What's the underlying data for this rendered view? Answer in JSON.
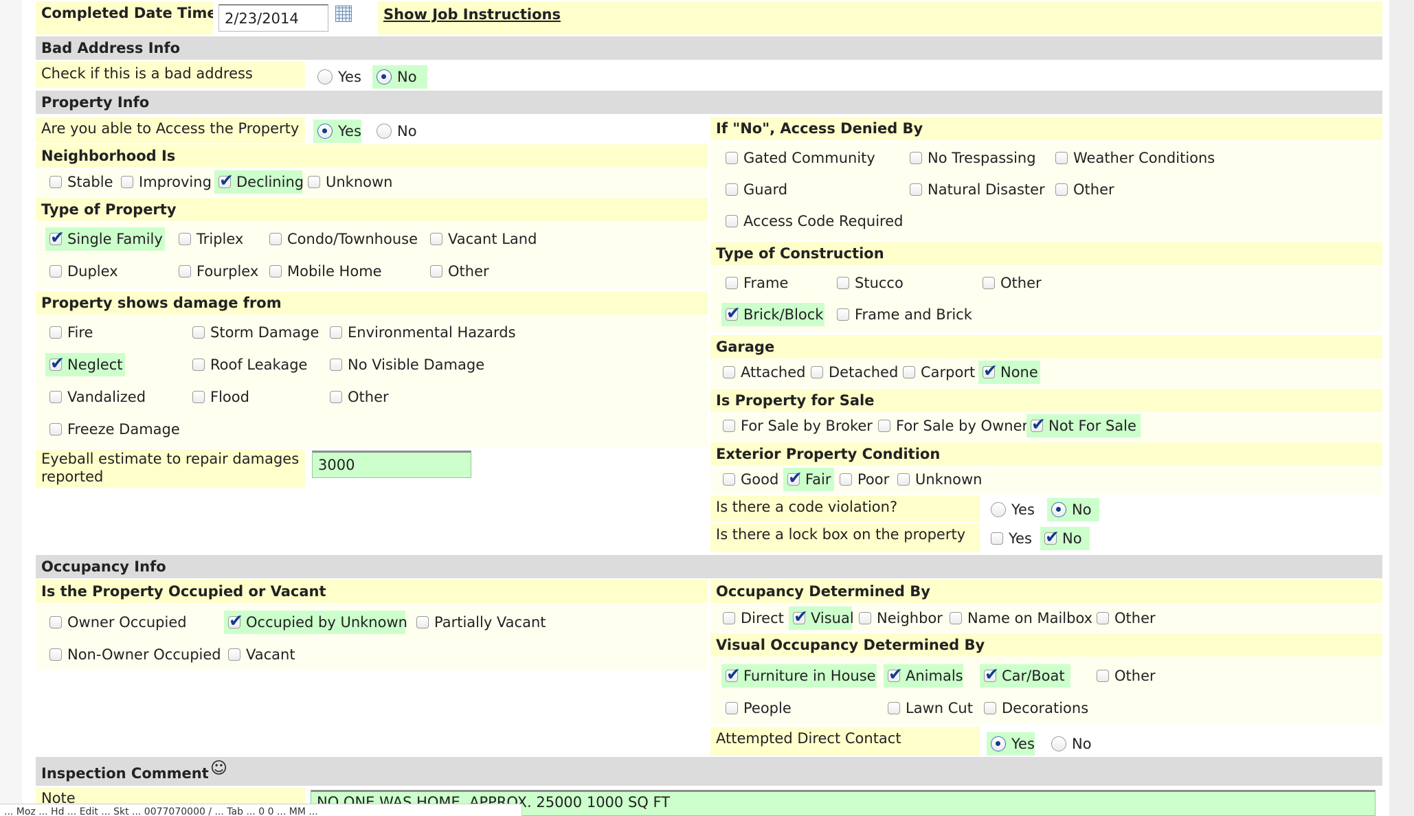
{
  "completed": {
    "label": "Completed Date Time",
    "date_value": "2/23/2014",
    "show_instructions": "Show Job Instructions"
  },
  "bad_address": {
    "section": "Bad Address Info",
    "question": "Check if this is a bad address",
    "options": [
      "Yes",
      "No"
    ],
    "selected": "No"
  },
  "property_info": {
    "section": "Property Info",
    "access_question": "Are you able to Access the Property",
    "access_options": [
      "Yes",
      "No"
    ],
    "access_selected": "Yes",
    "neighborhood": {
      "title": "Neighborhood Is",
      "options": [
        {
          "label": "Stable",
          "checked": false
        },
        {
          "label": "Improving",
          "checked": false
        },
        {
          "label": "Declining",
          "checked": true
        },
        {
          "label": "Unknown",
          "checked": false
        }
      ]
    },
    "type_of_property": {
      "title": "Type of Property",
      "options": [
        {
          "label": "Single Family",
          "checked": true
        },
        {
          "label": "Triplex",
          "checked": false
        },
        {
          "label": "Condo/Townhouse",
          "checked": false
        },
        {
          "label": "Vacant Land",
          "checked": false
        },
        {
          "label": "Duplex",
          "checked": false
        },
        {
          "label": "Fourplex",
          "checked": false
        },
        {
          "label": "Mobile Home",
          "checked": false
        },
        {
          "label": "Other",
          "checked": false
        }
      ]
    },
    "damage": {
      "title": "Property shows damage from",
      "options": [
        {
          "label": "Fire",
          "checked": false
        },
        {
          "label": "Storm Damage",
          "checked": false
        },
        {
          "label": "Environmental Hazards",
          "checked": false
        },
        {
          "label": "Neglect",
          "checked": true
        },
        {
          "label": "Roof Leakage",
          "checked": false
        },
        {
          "label": "No Visible Damage",
          "checked": false
        },
        {
          "label": "Vandalized",
          "checked": false
        },
        {
          "label": "Flood",
          "checked": false
        },
        {
          "label": "Other",
          "checked": false
        },
        {
          "label": "Freeze Damage",
          "checked": false
        }
      ]
    },
    "repair_estimate": {
      "label_line1": "Eyeball estimate to repair damages",
      "label_line2": "reported",
      "value": "3000"
    },
    "access_denied": {
      "title": "If \"No\", Access Denied By",
      "options": [
        {
          "label": "Gated Community",
          "checked": false
        },
        {
          "label": "No Trespassing",
          "checked": false
        },
        {
          "label": "Weather Conditions",
          "checked": false
        },
        {
          "label": "Guard",
          "checked": false
        },
        {
          "label": "Natural Disaster",
          "checked": false
        },
        {
          "label": "Other",
          "checked": false
        },
        {
          "label": "Access Code Required",
          "checked": false
        }
      ]
    },
    "construction": {
      "title": "Type of Construction",
      "options": [
        {
          "label": "Frame",
          "checked": false
        },
        {
          "label": "Stucco",
          "checked": false
        },
        {
          "label": "Other",
          "checked": false
        },
        {
          "label": "Brick/Block",
          "checked": true
        },
        {
          "label": "Frame and Brick",
          "checked": false
        }
      ]
    },
    "garage": {
      "title": "Garage",
      "options": [
        {
          "label": "Attached",
          "checked": false
        },
        {
          "label": "Detached",
          "checked": false
        },
        {
          "label": "Carport",
          "checked": false
        },
        {
          "label": "None",
          "checked": true
        }
      ]
    },
    "for_sale": {
      "title": "Is Property for Sale",
      "options": [
        {
          "label": "For Sale by Broker",
          "checked": false
        },
        {
          "label": "For Sale by Owner",
          "checked": false
        },
        {
          "label": "Not For Sale",
          "checked": true
        }
      ]
    },
    "exterior": {
      "title": "Exterior Property Condition",
      "options": [
        {
          "label": "Good",
          "checked": false
        },
        {
          "label": "Fair",
          "checked": true
        },
        {
          "label": "Poor",
          "checked": false
        },
        {
          "label": "Unknown",
          "checked": false
        }
      ]
    },
    "code_violation": {
      "question": "Is there a code violation?",
      "options": [
        "Yes",
        "No"
      ],
      "selected": "No"
    },
    "lock_box": {
      "question": "Is there a lock box on the property",
      "options": [
        {
          "label": "Yes",
          "checked": false
        },
        {
          "label": "No",
          "checked": true
        }
      ]
    }
  },
  "occupancy": {
    "section": "Occupancy Info",
    "occupied_or_vacant": {
      "title": "Is the Property Occupied or Vacant",
      "options": [
        {
          "label": "Owner Occupied",
          "checked": false
        },
        {
          "label": "Occupied by Unknown",
          "checked": true
        },
        {
          "label": "Partially Vacant",
          "checked": false
        },
        {
          "label": "Non-Owner Occupied",
          "checked": false
        },
        {
          "label": "Vacant",
          "checked": false
        }
      ]
    },
    "determined_by": {
      "title": "Occupancy Determined By",
      "options": [
        {
          "label": "Direct",
          "checked": false
        },
        {
          "label": "Visual",
          "checked": true
        },
        {
          "label": "Neighbor",
          "checked": false
        },
        {
          "label": "Name on Mailbox",
          "checked": false
        },
        {
          "label": "Other",
          "checked": false
        }
      ]
    },
    "visual_determined_by": {
      "title": "Visual Occupancy Determined By",
      "options": [
        {
          "label": "Furniture in House",
          "checked": true
        },
        {
          "label": "Animals",
          "checked": true
        },
        {
          "label": "Car/Boat",
          "checked": true
        },
        {
          "label": "Other",
          "checked": false
        },
        {
          "label": "People",
          "checked": false
        },
        {
          "label": "Lawn Cut",
          "checked": false
        },
        {
          "label": "Decorations",
          "checked": false
        }
      ]
    },
    "direct_contact": {
      "question": "Attempted Direct Contact",
      "options": [
        "Yes",
        "No"
      ],
      "selected": "Yes"
    }
  },
  "inspection": {
    "section": "Inspection Comment",
    "note_label": "Note",
    "note_value": "NO ONE WAS HOME.  APPROX. 25000  1000 SQ FT"
  },
  "status_bar": {
    "text": "... Moz ... Hd ... Edit ... Skt ... 0077070000 / ... Tab ... 0 0 ... MM ..."
  }
}
